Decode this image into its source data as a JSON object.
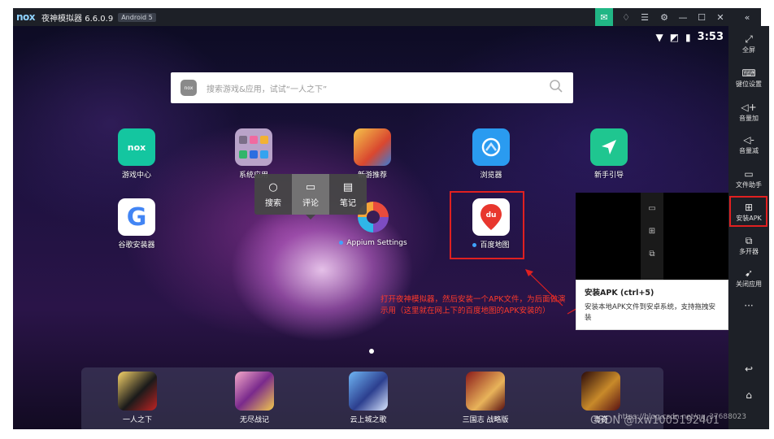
{
  "window": {
    "logo": "nox",
    "title": "夜神模拟器 6.6.0.9",
    "android_badge": "Android 5"
  },
  "status_bar": {
    "time": "3:53"
  },
  "search": {
    "placeholder": "搜索游戏&应用，试试“一人之下”",
    "logo_text": "nox"
  },
  "apps": [
    {
      "label": "游戏中心",
      "icon": "nox-game-center-icon",
      "color": "#14c6a0"
    },
    {
      "label": "系统应用",
      "icon": "system-apps-folder-icon",
      "color": "#b9a3c9"
    },
    {
      "label": "新游推荐",
      "icon": "new-games-icon",
      "color": "#e0a33a"
    },
    {
      "label": "浏览器",
      "icon": "browser-icon",
      "color": "#2a9bf0"
    },
    {
      "label": "新手引导",
      "icon": "guide-arrow-icon",
      "color": "#1fc690"
    },
    {
      "label": "谷歌安装器",
      "icon": "google-icon",
      "color": "#ffffff"
    },
    {
      "label": "Appium Settings",
      "icon": "appium-icon",
      "color": "#7d4cc2"
    },
    {
      "label": "百度地图",
      "icon": "baidu-map-icon",
      "color": "#ffffff"
    }
  ],
  "popup": {
    "items": [
      "搜索",
      "评论",
      "笔记"
    ]
  },
  "annotation": {
    "text": "打开夜神模拟器，然后安装一个APK文件，为后面做演示用（这里就在网上下的百度地图的APK安装的）"
  },
  "dock": {
    "apps": [
      "一人之下",
      "无尽战记",
      "云上城之歌",
      "三国志 战略版",
      "毒奇"
    ]
  },
  "tooltip": {
    "title": "安装APK (ctrl+5)",
    "desc": "安装本地APK文件到安卓系统，支持拖拽安装"
  },
  "sidebar": {
    "items": [
      "全屏",
      "键位设置",
      "音量加",
      "音量减",
      "文件助手",
      "安装APK",
      "多开器",
      "关闭应用"
    ]
  },
  "watermark": "CSDN @lxw1005192401",
  "watermark_url": "https://blog.csdn.net/qq_37688023",
  "colors": {
    "accent": "#21b685",
    "highlight": "#e02020",
    "annotation": "#ff3a2a"
  }
}
